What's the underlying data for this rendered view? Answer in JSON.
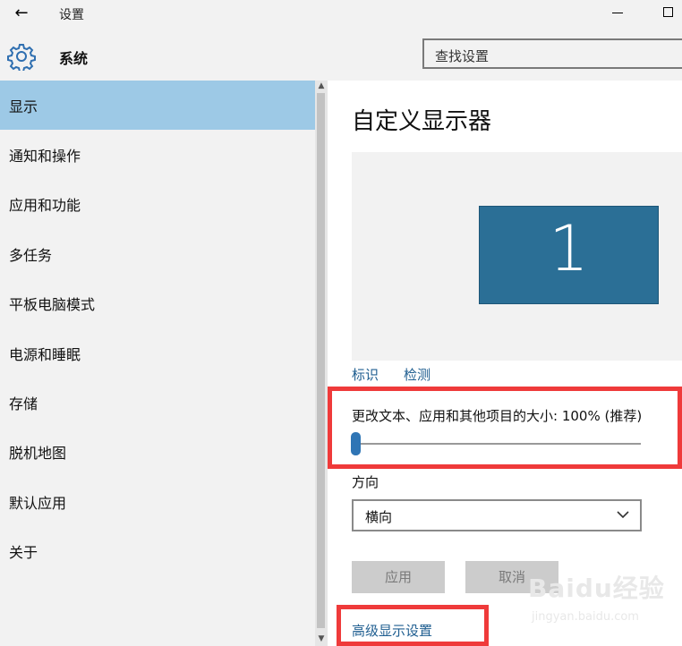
{
  "window": {
    "title": "设置"
  },
  "header": {
    "section_title": "系统",
    "search_placeholder": "查找设置"
  },
  "sidebar": {
    "items": [
      {
        "label": "显示",
        "selected": true
      },
      {
        "label": "通知和操作"
      },
      {
        "label": "应用和功能"
      },
      {
        "label": "多任务"
      },
      {
        "label": "平板电脑模式"
      },
      {
        "label": "电源和睡眠"
      },
      {
        "label": "存储"
      },
      {
        "label": "脱机地图"
      },
      {
        "label": "默认应用"
      },
      {
        "label": "关于"
      }
    ]
  },
  "main": {
    "title": "自定义显示器",
    "monitor_number": "1",
    "identify_link": "标识",
    "detect_link": "检测",
    "scale_label": "更改文本、应用和其他项目的大小: 100% (推荐)",
    "scale_value_percent": 0,
    "orientation_label": "方向",
    "orientation_value": "横向",
    "apply_button": "应用",
    "cancel_button": "取消",
    "advanced_link": "高级显示设置"
  },
  "watermark": {
    "logo": "Baidu经验",
    "url": "jingyan.baidu.com"
  },
  "colors": {
    "accent": "#2b6f96",
    "selected_nav": "#9dc9e6",
    "link": "#1f5e90",
    "highlight_box": "#ef3a3a"
  }
}
